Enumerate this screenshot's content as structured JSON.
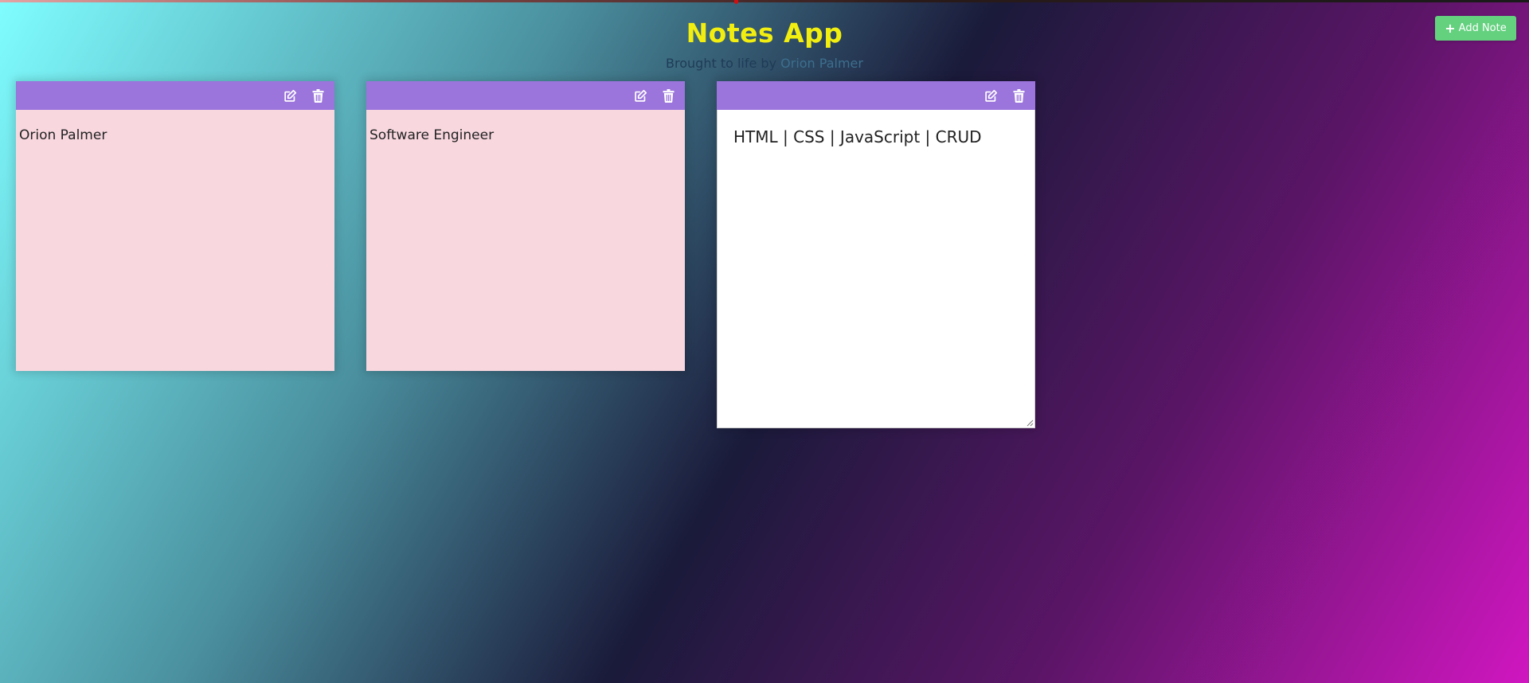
{
  "header": {
    "title": "Notes App",
    "subtitle_prefix": "Brought to life by",
    "subtitle_author": "Orion Palmer"
  },
  "toolbar": {
    "add_note_label": "Add Note",
    "add_note_icon": "plus-icon"
  },
  "notes": [
    {
      "text": "Orion Palmer",
      "mode": "view",
      "edit_icon": "edit-icon",
      "delete_icon": "trash-icon"
    },
    {
      "text": "Software Engineer",
      "mode": "view",
      "edit_icon": "edit-icon",
      "delete_icon": "trash-icon"
    },
    {
      "text": "HTML | CSS | JavaScript | CRUD",
      "mode": "edit",
      "edit_icon": "edit-icon",
      "delete_icon": "trash-icon"
    }
  ],
  "colors": {
    "title": "#f2ee10",
    "note_header": "#9b74dc",
    "note_body": "#f8d7df",
    "add_button": "#64d17f"
  }
}
